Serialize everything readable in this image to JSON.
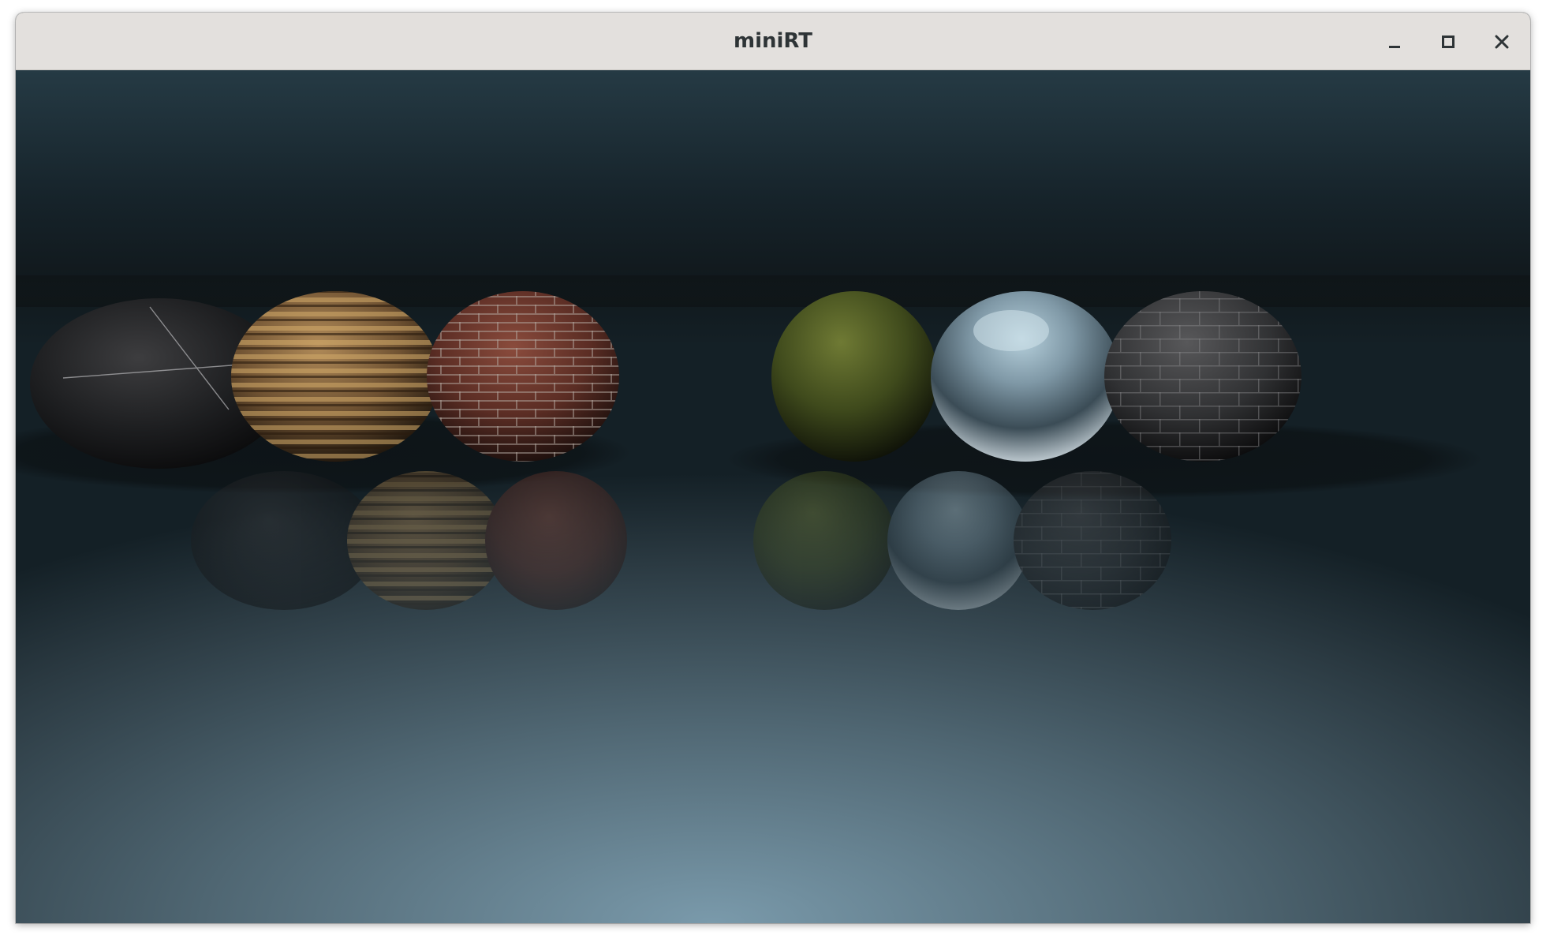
{
  "window": {
    "title": "miniRT",
    "controls": {
      "minimize_icon": "minimize-icon",
      "maximize_icon": "maximize-icon",
      "close_icon": "close-icon"
    }
  },
  "scene": {
    "colors": {
      "sky_top": "#253a44",
      "horizon": "#0f1518",
      "floor_glow": "#7a9aab",
      "floor_edge": "#3a4a52"
    },
    "objects": [
      {
        "name": "dark-marble-sphere",
        "material": "marble"
      },
      {
        "name": "wood-sphere",
        "material": "wood"
      },
      {
        "name": "brick-sphere",
        "material": "brick"
      },
      {
        "name": "grass-sphere",
        "material": "grass"
      },
      {
        "name": "chrome-sphere",
        "material": "mirror"
      },
      {
        "name": "slate-tile-sphere",
        "material": "stone-tiles"
      }
    ]
  }
}
